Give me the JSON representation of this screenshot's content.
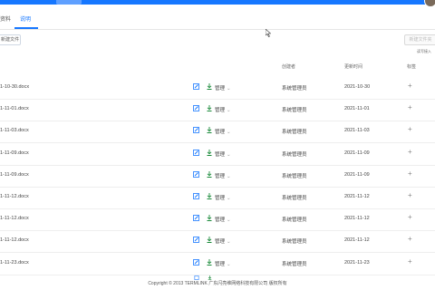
{
  "header": {
    "top_tab": ""
  },
  "tabs": [
    {
      "label": "资料",
      "active": false
    },
    {
      "label": "说明",
      "active": true
    }
  ],
  "toolbar": {
    "new_label": "新建文件",
    "right_button_label": "新建文件夹",
    "right_note": "读写接入"
  },
  "columns": {
    "creator": "创建者",
    "date": "更新时间",
    "action": "标签"
  },
  "rows": [
    {
      "name": "1-10-30.docx",
      "manage": "管理",
      "creator": "系统管理员",
      "date": "2021-10-30"
    },
    {
      "name": "1-11-01.docx",
      "manage": "管理",
      "creator": "系统管理员",
      "date": "2021-11-01"
    },
    {
      "name": "1-11-03.docx",
      "manage": "管理",
      "creator": "系统管理员",
      "date": "2021-11-03"
    },
    {
      "name": "1-11-09.docx",
      "manage": "管理",
      "creator": "系统管理员",
      "date": "2021-11-09"
    },
    {
      "name": "1-11-09.docx",
      "manage": "管理",
      "creator": "系统管理员",
      "date": "2021-11-09"
    },
    {
      "name": "1-11-12.docx",
      "manage": "管理",
      "creator": "系统管理员",
      "date": "2021-11-12"
    },
    {
      "name": "1-11-12.docx",
      "manage": "管理",
      "creator": "系统管理员",
      "date": "2021-11-12"
    },
    {
      "name": "1-11-12.docx",
      "manage": "管理",
      "creator": "系统管理员",
      "date": "2021-11-12"
    },
    {
      "name": "1-11-23.docx",
      "manage": "管理",
      "creator": "系统管理员",
      "date": "2021-11-23"
    }
  ],
  "footer": {
    "text": "Copyright © 2013 TERMLINK 广东闪亮维网络科技有限公司 版权所有"
  },
  "colors": {
    "accent": "#1677ff",
    "border": "#eeeeee"
  },
  "icons": {
    "edit": "edit-icon",
    "download": "download-icon",
    "add": "plus-icon"
  }
}
